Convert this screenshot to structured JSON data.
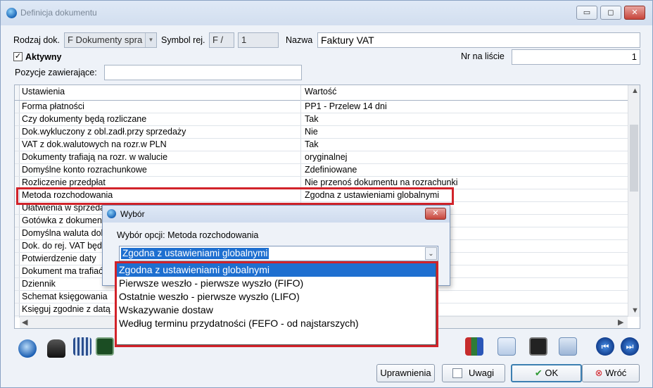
{
  "window": {
    "title": "Definicja dokumentu",
    "min_glyph": "▭",
    "restore_glyph": "◻",
    "close_glyph": "✕"
  },
  "form": {
    "rodzaj_label": "Rodzaj dok.",
    "rodzaj_value": "F  Dokumenty spra",
    "symbol_label": "Symbol rej.",
    "symbol_prefix": "F /",
    "symbol_num": "1",
    "nazwa_label": "Nazwa",
    "nazwa_value": "Faktury VAT",
    "aktywny_label": "Aktywny",
    "aktywny_checked": "✓",
    "nr_label": "Nr na liście",
    "nr_value": "1",
    "pozycje_label": "Pozycje zawierające:",
    "pozycje_value": ""
  },
  "grid": {
    "col1": "Ustawienia",
    "col2": "Wartość",
    "rows": [
      {
        "name": "Forma płatności",
        "value": "PP1 - Przelew 14 dni"
      },
      {
        "name": "Czy dokumenty będą rozliczane",
        "value": "Tak"
      },
      {
        "name": "Dok.wykluczony z obl.zadł.przy sprzedaży",
        "value": "Nie"
      },
      {
        "name": "VAT z dok.walutowych na rozr.w PLN",
        "value": "Tak"
      },
      {
        "name": "Dokumenty trafiają na rozr. w walucie",
        "value": "oryginalnej"
      },
      {
        "name": "Domyślne konto rozrachunkowe",
        "value": "Zdefiniowane"
      },
      {
        "name": "Rozliczenie przedpłat",
        "value": "Nie przenoś dokumentu na rozrachunki"
      },
      {
        "name": "Metoda rozchodowania",
        "value": "Zgodna z ustawieniami globalnymi"
      },
      {
        "name": "Ułatwienia w sprzedaży",
        "value": ""
      },
      {
        "name": "Gotówka z dokumentu",
        "value": ""
      },
      {
        "name": "Domyślna waluta dokumentu",
        "value": ""
      },
      {
        "name": "Dok. do rej. VAT będą",
        "value": ""
      },
      {
        "name": "Potwierdzenie daty",
        "value": ""
      },
      {
        "name": "Dokument ma trafiać",
        "value": ""
      },
      {
        "name": "Dziennik",
        "value": ""
      },
      {
        "name": "Schemat księgowania",
        "value": ""
      },
      {
        "name": "Księguj zgodnie z datą",
        "value": ""
      }
    ]
  },
  "dialog": {
    "title": "Wybór",
    "prompt": "Wybór opcji:  Metoda rozchodowania",
    "selected": "Zgodna z ustawieniami globalnymi",
    "options": [
      "Zgodna z ustawieniami globalnymi",
      "Pierwsze weszło - pierwsze wyszło (FIFO)",
      "Ostatnie weszło - pierwsze wyszło (LIFO)",
      "Wskazywanie dostaw",
      "Według terminu przydatności (FEFO - od najstarszych)"
    ]
  },
  "buttons": {
    "uprawnienia": "Uprawnienia",
    "uwagi": "Uwagi",
    "ok": "OK",
    "wroc": "Wróć"
  },
  "colors": {
    "highlight_red": "#d2232a",
    "selection_blue": "#1e6fd0"
  }
}
